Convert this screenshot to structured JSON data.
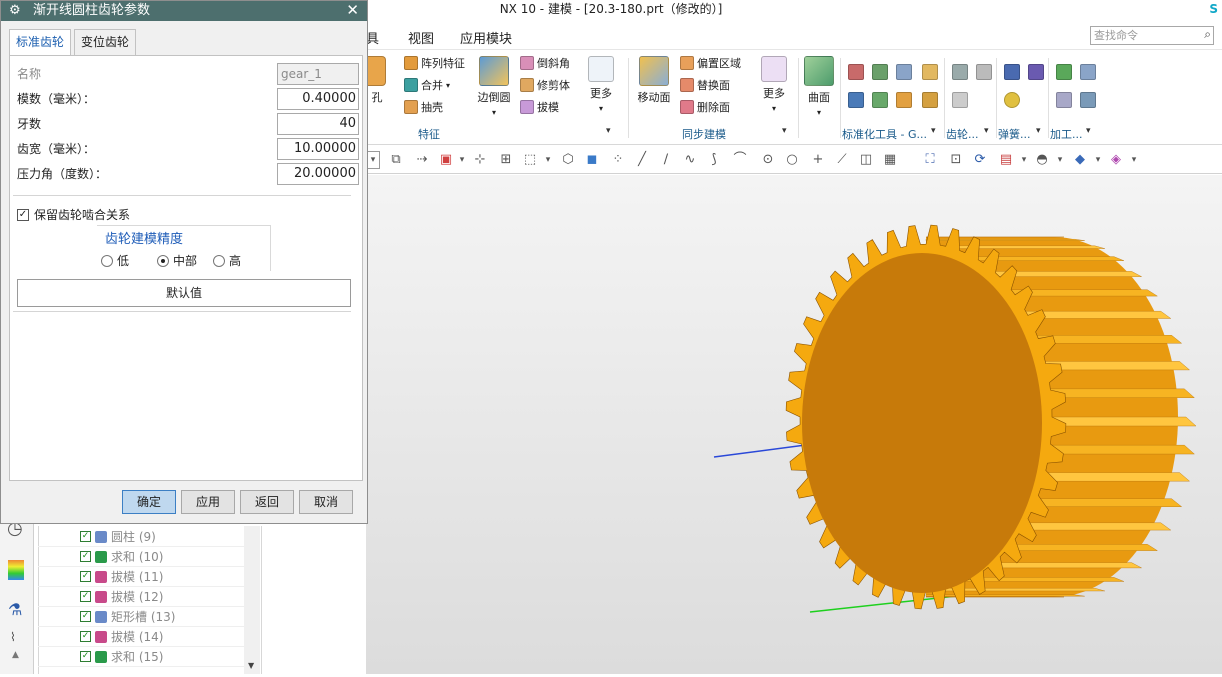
{
  "window": {
    "title": "NX 10 - 建模 - [20.3-180.prt（修改的）]",
    "brand": "S"
  },
  "menu": {
    "items": [
      "具",
      "视图",
      "应用模块"
    ],
    "search_placeholder": "查找命令"
  },
  "ribbon": {
    "hole": "孔",
    "array_feature": "阵列特征",
    "combine": "合并",
    "shell": "抽壳",
    "edge_blend": "边倒圆",
    "chamfer": "倒斜角",
    "trim_body": "修剪体",
    "draft": "拔模",
    "more1": "更多",
    "group_feature": "特征",
    "move_face": "移动面",
    "offset_region": "偏置区域",
    "replace_face": "替换面",
    "delete_face": "删除面",
    "more2": "更多",
    "group_sync": "同步建模",
    "surface": "曲面",
    "group_std": "标准化工具 - G...",
    "group_gear": "齿轮...",
    "group_spring": "弹簧...",
    "group_machining": "加工..."
  },
  "dialog": {
    "title": "渐开线圆柱齿轮参数",
    "tabs": [
      "标准齿轮",
      "变位齿轮"
    ],
    "fields": {
      "name_label": "名称",
      "name_value": "gear_1",
      "module_label": "模数（毫米）：",
      "module_value": "0.40000",
      "teeth_label": "牙数",
      "teeth_value": "40",
      "width_label": "齿宽（毫米）：",
      "width_value": "10.00000",
      "pressure_label": "压力角（度数）：",
      "pressure_value": "20.00000"
    },
    "keep_mesh_label": "保留齿轮啮合关系",
    "keep_mesh_checked": true,
    "precision_title": "齿轮建模精度",
    "precision_options": [
      "低",
      "中部",
      "高"
    ],
    "precision_selected": "中部",
    "default_button": "默认值",
    "buttons": {
      "ok": "确定",
      "apply": "应用",
      "back": "返回",
      "cancel": "取消"
    }
  },
  "tree": {
    "rows": [
      "圆柱 (9)",
      "求和 (10)",
      "拔模 (11)",
      "拔模 (12)",
      "矩形槽 (13)",
      "拔模 (14)",
      "求和 (15)"
    ]
  },
  "colors": {
    "dialog_title_bg": "#4d6f6e",
    "gear_face": "#c77a0a",
    "gear_teeth": "#f5a90f",
    "accent": "#1f5db8"
  }
}
